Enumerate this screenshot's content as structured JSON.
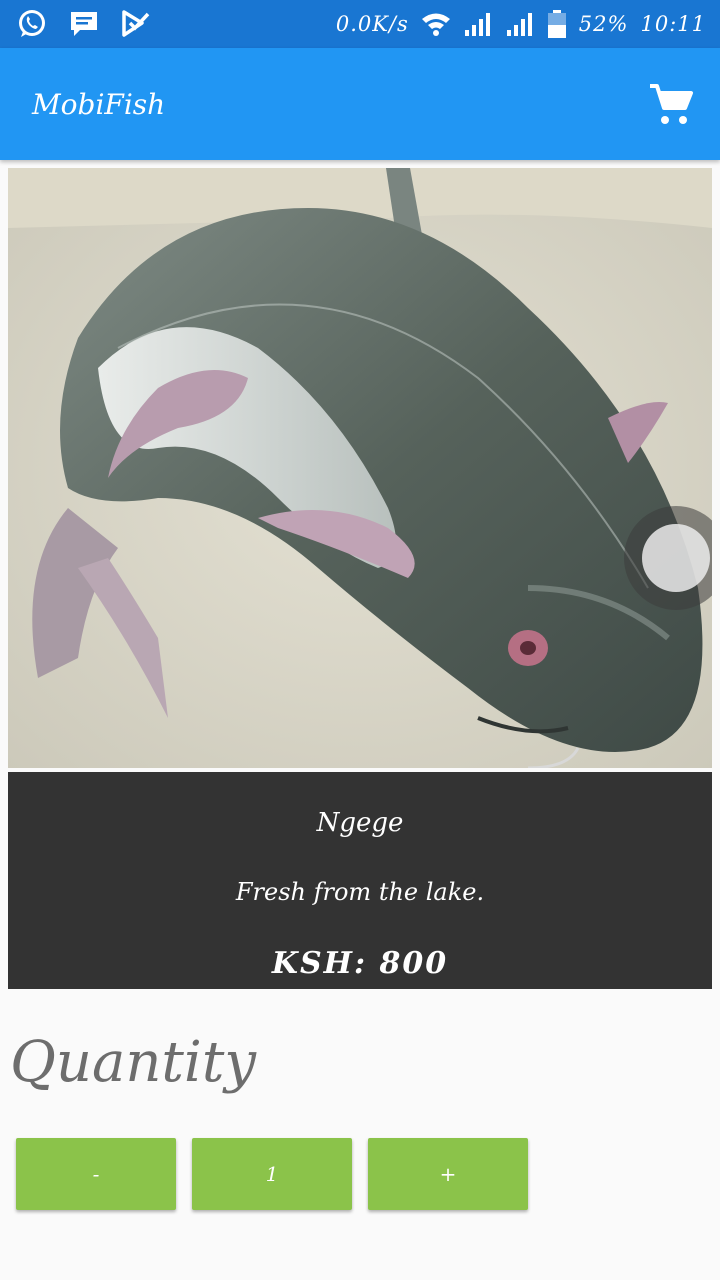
{
  "status_bar": {
    "net_speed": "0.0K/s",
    "battery": "52%",
    "time": "10:11",
    "icons": [
      "whatsapp-icon",
      "sms-icon",
      "task-icon",
      "wifi-icon",
      "signal-icon",
      "signal-icon",
      "battery-icon"
    ]
  },
  "app_bar": {
    "title": "MobiFish",
    "cart_icon": "shopping-cart-icon"
  },
  "product": {
    "image_desc": "fish-photo",
    "name": "Ngege",
    "description": "Fresh from the lake.",
    "price": "KSH: 800"
  },
  "quantity": {
    "label": "Quantity",
    "minus_label": "-",
    "value": "1",
    "plus_label": "+"
  },
  "colors": {
    "status_bar": "#1976d2",
    "app_bar": "#2196f3",
    "card": "#333333",
    "button": "#8bc34a"
  }
}
